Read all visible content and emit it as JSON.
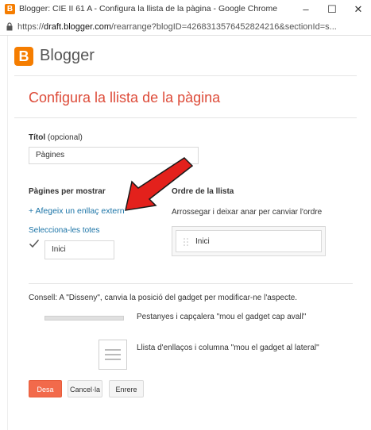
{
  "window": {
    "title": "Blogger: CIE II 61 A - Configura la llista de la pàgina - Google Chrome",
    "minimize": "–",
    "maximize": "☐",
    "close": "✕"
  },
  "address_bar": {
    "scheme": "https://",
    "domain": "draft.blogger.com",
    "path": "/rearrange?blogID=4268313576452824216&sectionId=s..."
  },
  "header": {
    "logo_letter": "B",
    "brand": "Blogger"
  },
  "dialog": {
    "title": "Configura la llista de la pàgina",
    "title_field": {
      "label": "Títol",
      "hint": "(opcional)",
      "value": "Pàgines"
    },
    "pages_section": {
      "heading": "Pàgines per mostrar",
      "add_link": "+ Afegeix un enllaç extern",
      "select_all": "Selecciona-les totes",
      "items": [
        {
          "label": "Inici",
          "checked": true
        }
      ]
    },
    "order_section": {
      "heading": "Ordre de la llista",
      "instructions": "Arrossegar i deixar anar per canviar l'ordre",
      "items": [
        {
          "label": "Inici"
        }
      ]
    },
    "tip": {
      "text": "Consell: A \"Disseny\", canvia la posició del gadget per modificar-ne l'aspecte.",
      "layout_tabs": "Pestanyes i capçalera \"mou el gadget cap avall\"",
      "layout_list": "Llista d'enllaços i columna \"mou el gadget al lateral\""
    },
    "buttons": {
      "save": "Desa",
      "cancel": "Cancel·la",
      "back": "Enrere"
    }
  },
  "colors": {
    "accent": "#dd4b39",
    "link": "#1a73a6",
    "primary_button": "#f26a4b",
    "annotation_arrow": "#e3211c"
  },
  "annotation": {
    "type": "arrow",
    "points_to": "add_link"
  }
}
